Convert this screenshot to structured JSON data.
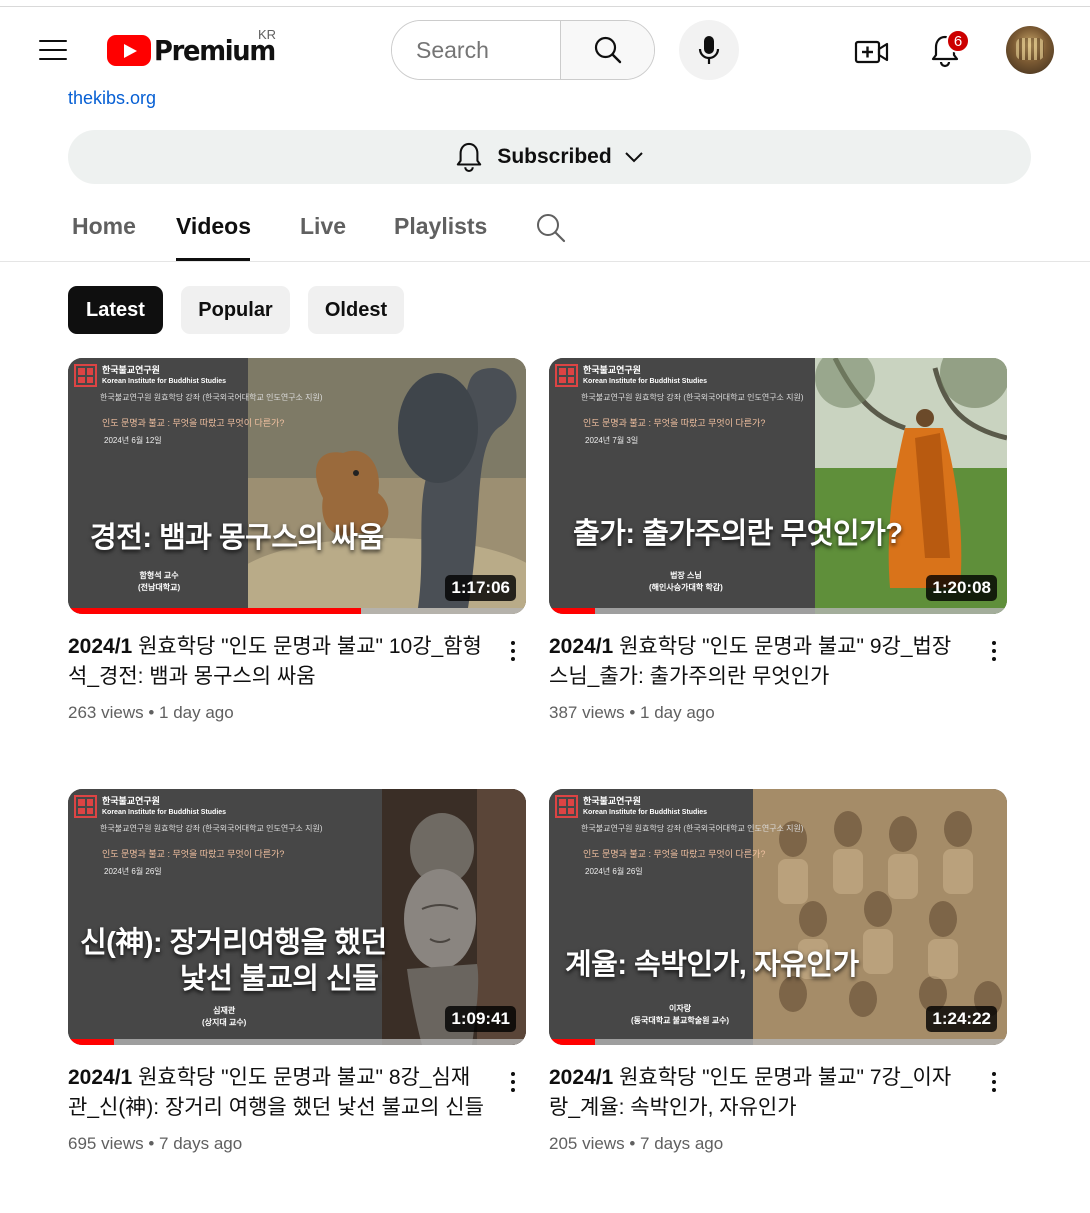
{
  "header": {
    "logo_text": "Premium",
    "country_code": "KR",
    "search_placeholder": "Search",
    "notification_count": "6"
  },
  "channel": {
    "link_text": "thekibs.org",
    "subscribe_label": "Subscribed"
  },
  "tabs": [
    {
      "label": "Home",
      "active": false
    },
    {
      "label": "Videos",
      "active": true
    },
    {
      "label": "Live",
      "active": false
    },
    {
      "label": "Playlists",
      "active": false
    }
  ],
  "chips": [
    {
      "label": "Latest",
      "active": true
    },
    {
      "label": "Popular",
      "active": false
    },
    {
      "label": "Oldest",
      "active": false
    }
  ],
  "colors": {
    "brand_red": "#ff0000",
    "link_blue": "#065fd4",
    "badge_red": "#cc0000"
  },
  "videos": [
    {
      "title_bold": "2024/1",
      "title_rest": " 원효학당 \"인도 문명과 불교\" 10강_함형석_경전: 뱀과 몽구스의 싸움",
      "views": "263 views",
      "age": "1 day ago",
      "duration": "1:17:06",
      "watched_fraction": 0.64,
      "thumb": {
        "org": "한국불교연구원",
        "org_en": "Korean Institute for Buddhist Studies",
        "sub": "한국불교연구원 원효학당 강좌 (한국외국어대학교 인도연구소 지원)",
        "series": "인도 문명과 불교 : 무엇을 따랐고 무엇이 다른가?",
        "date": "2024년 6월 12일",
        "title": "경전: 뱀과 몽구스의 싸움",
        "presenter_1": "함형석 교수",
        "presenter_2": "(전남대학교)"
      }
    },
    {
      "title_bold": "2024/1",
      "title_rest": " 원효학당 \"인도 문명과 불교\" 9강_법장스님_출가: 출가주의란 무엇인가",
      "views": "387 views",
      "age": "1 day ago",
      "duration": "1:20:08",
      "watched_fraction": 0.1,
      "thumb": {
        "org": "한국불교연구원",
        "org_en": "Korean Institute for Buddhist Studies",
        "sub": "한국불교연구원 원효학당 강좌 (한국외국어대학교 인도연구소 지원)",
        "series": "인도 문명과 불교 : 무엇을 따랐고 무엇이 다른가?",
        "date": "2024년 7월 3일",
        "title": "출가: 출가주의란 무엇인가?",
        "presenter_1": "법장 스님",
        "presenter_2": "(해인사승가대학 학감)"
      }
    },
    {
      "title_bold": "2024/1",
      "title_rest": " 원효학당 \"인도 문명과 불교\" 8강_심재관_신(神): 장거리 여행을 했던 낯선 불교의 신들",
      "views": "695 views",
      "age": "7 days ago",
      "duration": "1:09:41",
      "watched_fraction": 0.1,
      "thumb": {
        "org": "한국불교연구원",
        "org_en": "Korean Institute for Buddhist Studies",
        "sub": "한국불교연구원 원효학당 강좌 (한국외국어대학교 인도연구소 지원)",
        "series": "인도 문명과 불교 : 무엇을 따랐고 무엇이 다른가?",
        "date": "2024년 6월 26일",
        "title": "신(神): 장거리여행을 했던",
        "title_line2": "낯선 불교의 신들",
        "presenter_1": "심재관",
        "presenter_2": "(상지대 교수)"
      }
    },
    {
      "title_bold": "2024/1",
      "title_rest": " 원효학당 \"인도 문명과 불교\" 7강_이자랑_계율: 속박인가, 자유인가",
      "views": "205 views",
      "age": "7 days ago",
      "duration": "1:24:22",
      "watched_fraction": 0.1,
      "thumb": {
        "org": "한국불교연구원",
        "org_en": "Korean Institute for Buddhist Studies",
        "sub": "한국불교연구원 원효학당 강좌 (한국외국어대학교 인도연구소 지원)",
        "series": "인도 문명과 불교 : 무엇을 따랐고 무엇이 다른가?",
        "date": "2024년 6월 26일",
        "title": "계율: 속박인가, 자유인가",
        "presenter_1": "이자랑",
        "presenter_2": "(동국대학교 불교학술원 교수)"
      }
    }
  ]
}
